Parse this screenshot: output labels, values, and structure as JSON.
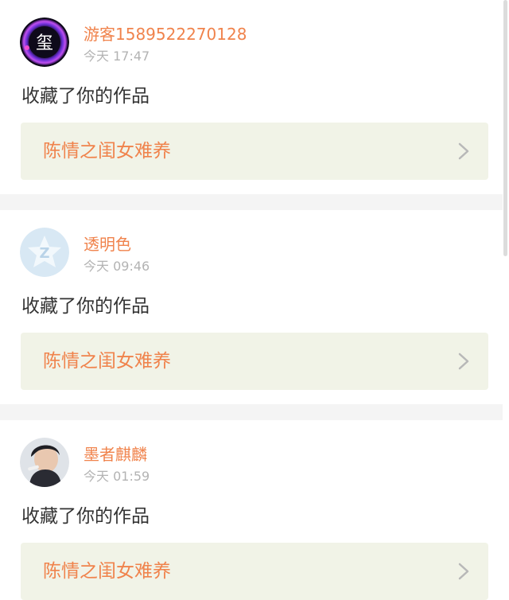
{
  "notifications": [
    {
      "username": "游客1589522270128",
      "time": "今天 17:47",
      "action": "收藏了你的作品",
      "work_title": "陈情之闺女难养",
      "avatar_icon": "purple-orb-avatar-icon"
    },
    {
      "username": "透明色",
      "time": "今天 09:46",
      "action": "收藏了你的作品",
      "work_title": "陈情之闺女难养",
      "avatar_icon": "default-z-avatar-icon"
    },
    {
      "username": "墨者麒麟",
      "time": "今天 01:59",
      "action": "收藏了你的作品",
      "work_title": "陈情之闺女难养",
      "avatar_icon": "portrait-avatar-icon"
    }
  ],
  "colors": {
    "accent": "#f0834c",
    "muted": "#b3b3b3",
    "text": "#333333",
    "link_bg": "#f1f3e7",
    "separator": "#f4f4f4"
  }
}
